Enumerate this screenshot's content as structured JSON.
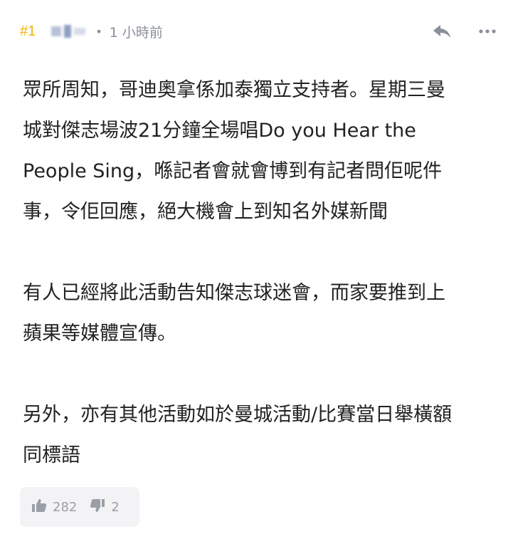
{
  "post": {
    "number": "#1",
    "separator": "•",
    "time": "1 小時前"
  },
  "icons": {
    "reply": "reply-arrow-icon",
    "more": "more-dots-icon",
    "like": "thumbs-up-icon",
    "dislike": "thumbs-down-icon"
  },
  "content": {
    "paragraphs": [
      "眾所周知，哥迪奧拿係加泰獨立支持者。星期三曼\n城對傑志場波21分鐘全場唱Do you Hear the\nPeople Sing，喺記者會就會博到有記者問佢呢件\n事，令佢回應，絕大機會上到知名外媒新聞",
      "有人已經將此活動告知傑志球迷會，而家要推到上\n蘋果等媒體宣傳。",
      "另外，亦有其他活動如於曼城活動/比賽當日舉橫額\n同標語"
    ]
  },
  "votes": {
    "likes": "282",
    "dislikes": "2"
  },
  "colors": {
    "post_number": "#f0b400",
    "meta_text": "#8a8f99",
    "vote_bg": "#f3f3f5"
  }
}
